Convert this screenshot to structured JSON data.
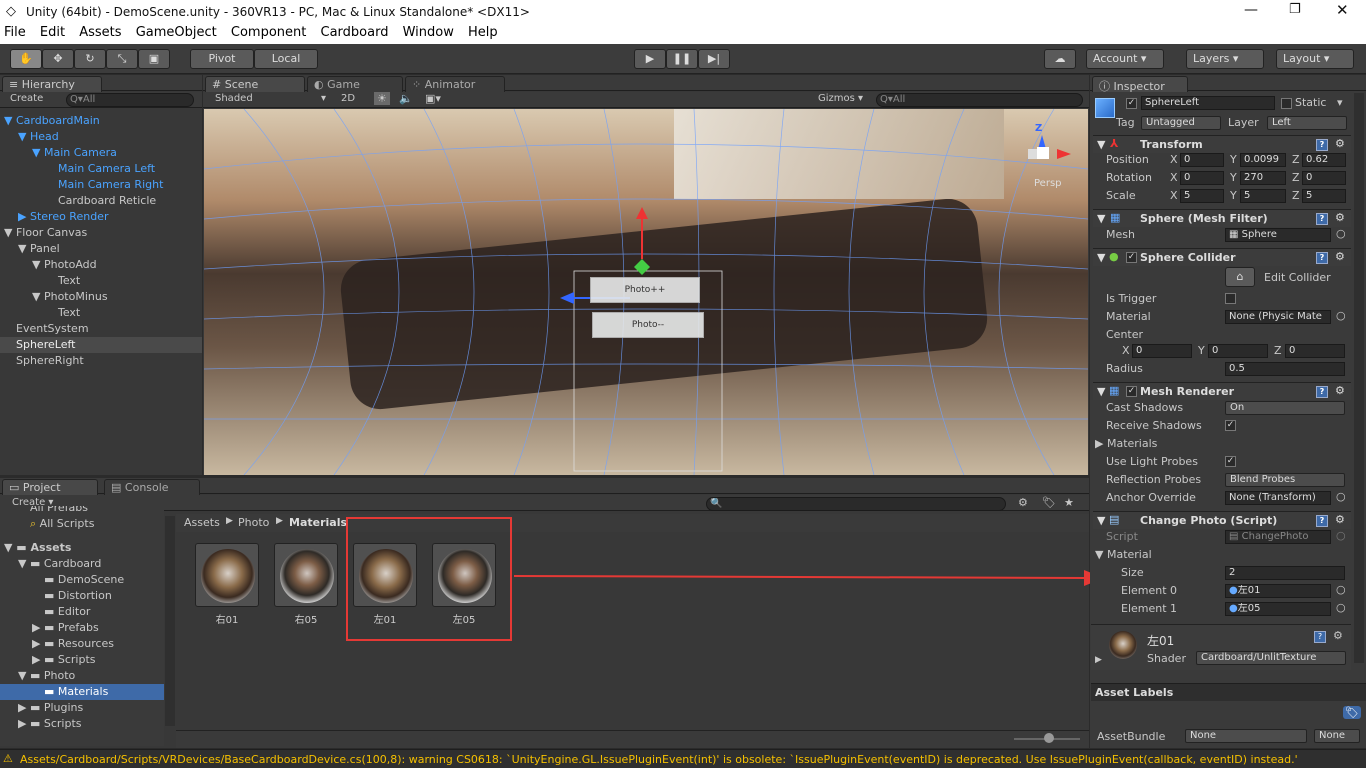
{
  "window": {
    "title": "Unity (64bit) - DemoScene.unity - 360VR13 - PC, Mac & Linux Standalone* <DX11>"
  },
  "menu": [
    "File",
    "Edit",
    "Assets",
    "GameObject",
    "Component",
    "Cardboard",
    "Window",
    "Help"
  ],
  "toolbar": {
    "pivot": "Pivot",
    "local": "Local",
    "account": "Account",
    "layers": "Layers",
    "layout": "Layout"
  },
  "hierarchy": {
    "tab": "Hierarchy",
    "create": "Create",
    "search_placeholder": "Q▾All",
    "items": [
      "CardboardMain",
      "Head",
      "Main Camera",
      "Main Camera Left",
      "Main Camera Right",
      "Cardboard Reticle",
      "Stereo Render",
      "Floor Canvas",
      "Panel",
      "PhotoAdd",
      "Text",
      "PhotoMinus",
      "Text",
      "EventSystem",
      "SphereLeft",
      "SphereRight"
    ]
  },
  "scene": {
    "tabs": [
      "Scene",
      "Game",
      "Animator"
    ],
    "shaded": "Shaded",
    "mode2d": "2D",
    "gizmos": "Gizmos",
    "search_placeholder": "Q▾All",
    "buttons": [
      "Photo++",
      "Photo--"
    ],
    "persp": "Persp"
  },
  "project": {
    "tabs": [
      "Project",
      "Console"
    ],
    "create": "Create",
    "favorites": [
      "All Prefabs",
      "All Scripts"
    ],
    "tree": [
      "Assets",
      "Cardboard",
      "DemoScene",
      "Distortion",
      "Editor",
      "Prefabs",
      "Resources",
      "Scripts",
      "Photo",
      "Materials",
      "Plugins",
      "Scripts"
    ],
    "breadcrumb": [
      "Assets",
      "Photo",
      "Materials"
    ],
    "assets": [
      "右01",
      "右05",
      "左01",
      "左05"
    ]
  },
  "inspector": {
    "tab": "Inspector",
    "name": "SphereLeft",
    "static": "Static",
    "tag_label": "Tag",
    "tag": "Untagged",
    "layer_label": "Layer",
    "layer": "Left",
    "transform": {
      "title": "Transform",
      "position": {
        "label": "Position",
        "x": "0",
        "y": "0.0099",
        "z": "0.62"
      },
      "rotation": {
        "label": "Rotation",
        "x": "0",
        "y": "270",
        "z": "0"
      },
      "scale": {
        "label": "Scale",
        "x": "5",
        "y": "5",
        "z": "5"
      }
    },
    "mesh_filter": {
      "title": "Sphere (Mesh Filter)",
      "mesh_label": "Mesh",
      "mesh": "Sphere"
    },
    "collider": {
      "title": "Sphere Collider",
      "edit": "Edit Collider",
      "is_trigger": "Is Trigger",
      "material_label": "Material",
      "material": "None (Physic Mate",
      "center": "Center",
      "cx": "0",
      "cy": "0",
      "cz": "0",
      "radius_label": "Radius",
      "radius": "0.5"
    },
    "renderer": {
      "title": "Mesh Renderer",
      "cast_label": "Cast Shadows",
      "cast": "On",
      "receive_label": "Receive Shadows",
      "materials": "Materials",
      "light_label": "Use Light Probes",
      "refl_label": "Reflection Probes",
      "refl": "Blend Probes",
      "anchor_label": "Anchor Override",
      "anchor": "None (Transform)"
    },
    "script": {
      "title": "Change Photo (Script)",
      "script_label": "Script",
      "script": "ChangePhoto",
      "material": "Material",
      "size_label": "Size",
      "size": "2",
      "e0_label": "Element 0",
      "e0": "左01",
      "e1_label": "Element 1",
      "e1": "左05"
    },
    "material_preview": {
      "name": "左01",
      "shader_label": "Shader",
      "shader": "Cardboard/UnlitTexture"
    },
    "asset_labels": "Asset Labels",
    "asset_bundle": {
      "label": "AssetBundle",
      "value": "None",
      "variant": "None"
    }
  },
  "status": {
    "message": "Assets/Cardboard/Scripts/VRDevices/BaseCardboardDevice.cs(100,8): warning CS0618: `UnityEngine.GL.IssuePluginEvent(int)' is obsolete: `IssuePluginEvent(eventID) is deprecated. Use IssuePluginEvent(callback, eventID) instead.'"
  },
  "colors": {
    "accent_blue": "#3e6aa8",
    "highlight_red": "#e53935",
    "prefab_blue": "#4aa3ff"
  }
}
